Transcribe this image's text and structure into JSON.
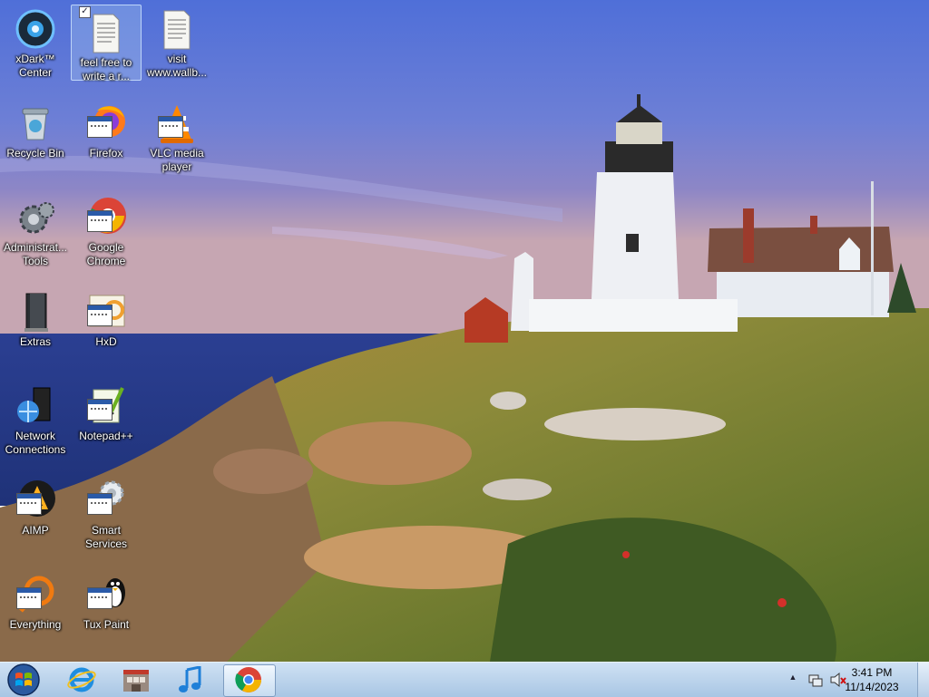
{
  "desktop": {
    "icons": [
      {
        "label": "xDark™ Center",
        "icon": "xdark-center-icon"
      },
      {
        "label": "feel free to write a r...",
        "icon": "text-file-icon",
        "selected": true
      },
      {
        "label": "visit www.wallb...",
        "icon": "text-file-icon"
      },
      {
        "label": "Recycle Bin",
        "icon": "recycle-bin-icon"
      },
      {
        "label": "Firefox",
        "icon": "firefox-icon"
      },
      {
        "label": "VLC media player",
        "icon": "vlc-icon"
      },
      {
        "label": "Administrat... Tools",
        "icon": "administrative-tools-icon"
      },
      {
        "label": "Google Chrome",
        "icon": "chrome-icon"
      },
      {
        "label": "Extras",
        "icon": "extras-icon"
      },
      {
        "label": "HxD",
        "icon": "hxd-icon"
      },
      {
        "label": "Network Connections",
        "icon": "network-connections-icon"
      },
      {
        "label": "Notepad++",
        "icon": "notepad-plus-plus-icon"
      },
      {
        "label": "AIMP",
        "icon": "aimp-icon"
      },
      {
        "label": "Smart Services",
        "icon": "smart-services-icon"
      },
      {
        "label": "Everything",
        "icon": "everything-icon"
      },
      {
        "label": "Tux Paint",
        "icon": "tux-paint-icon"
      }
    ]
  },
  "taskbar": {
    "start_icon": "windows-start-orb-icon",
    "pinned": [
      {
        "name": "internet-explorer",
        "icon": "internet-explorer-icon"
      },
      {
        "name": "store-app",
        "icon": "store-icon"
      },
      {
        "name": "music-player",
        "icon": "music-note-icon"
      },
      {
        "name": "google-chrome",
        "icon": "chrome-icon",
        "active": true
      }
    ],
    "tray": {
      "network_icon": "network-icon",
      "volume_icon": "volume-muted-icon"
    },
    "clock": {
      "time": "3:41 PM",
      "date": "11/14/2023"
    }
  },
  "colors": {
    "taskbar_top": "#cfe1f3",
    "taskbar_bottom": "#a9c6e4",
    "selection": "#aac8f0"
  }
}
